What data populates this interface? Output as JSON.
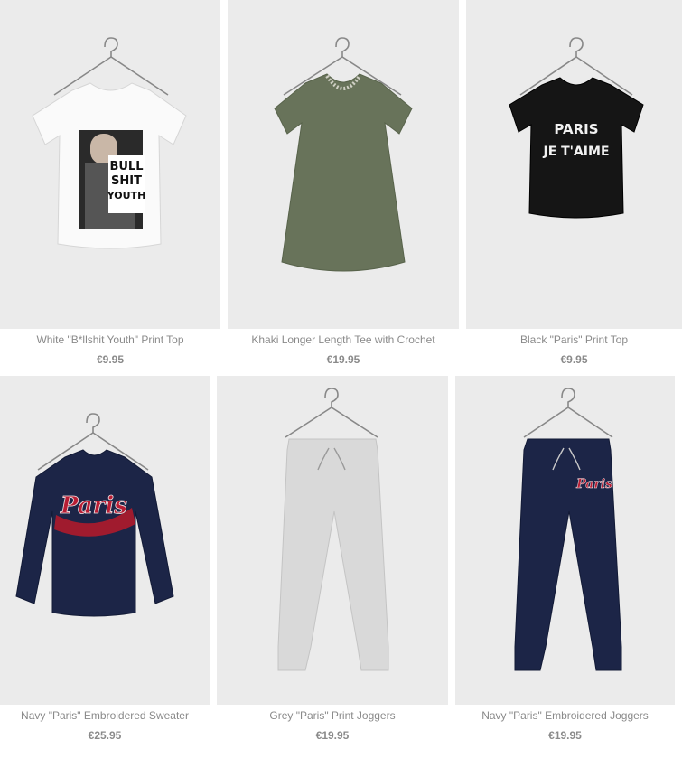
{
  "products": [
    {
      "name": "White \"B*llshit Youth\" Print Top",
      "price": "€9.95",
      "print": [
        "BULL",
        "SHIT",
        "YOUTH"
      ],
      "color": "#fafafa"
    },
    {
      "name": "Khaki Longer Length Tee with Crochet",
      "price": "€19.95",
      "color": "#68735a"
    },
    {
      "name": "Black \"Paris\" Print Top",
      "price": "€9.95",
      "print": [
        "PARIS",
        "JE T'AIME"
      ],
      "color": "#151515"
    },
    {
      "name": "Navy \"Paris\" Embroidered Sweater",
      "price": "€25.95",
      "print": [
        "Paris"
      ],
      "color": "#1c2547"
    },
    {
      "name": "Grey \"Paris\" Print Joggers",
      "price": "€19.95",
      "color": "#d9d9d9"
    },
    {
      "name": "Navy \"Paris\" Embroidered Joggers",
      "price": "€19.95",
      "print": [
        "Paris"
      ],
      "color": "#1c2547"
    }
  ],
  "icons": {
    "hanger": "hanger-icon"
  }
}
